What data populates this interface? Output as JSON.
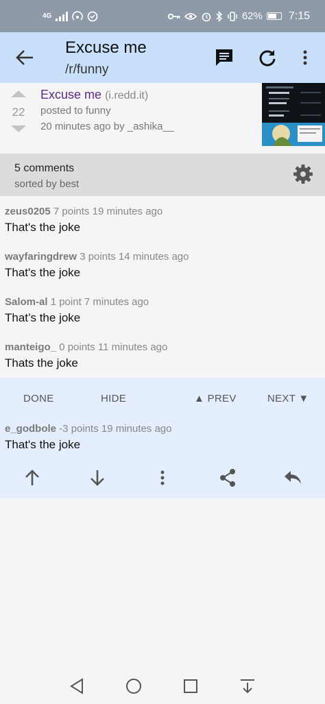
{
  "status_bar": {
    "network": "4G",
    "battery": "62%",
    "time": "7:15"
  },
  "app_bar": {
    "title": "Excuse me",
    "subtitle": "/r/funny"
  },
  "post": {
    "score": "22",
    "title": "Excuse me",
    "domain": "(i.redd.it)",
    "posted_to": "posted to funny",
    "time_by": "20 minutes ago by _ashika__"
  },
  "comments_header": {
    "count": "5 comments",
    "sort": "sorted by best"
  },
  "comments": [
    {
      "author": "zeus0205",
      "points": "7 points",
      "time": "19 minutes ago",
      "body": "That's the joke"
    },
    {
      "author": "wayfaringdrew",
      "points": "3 points",
      "time": "14 minutes ago",
      "body": "That's the joke"
    },
    {
      "author": "Salom-al",
      "points": "1 point",
      "time": "7 minutes ago",
      "body": "That’s the joke"
    },
    {
      "author": "manteigo_",
      "points": "0 points",
      "time": "11 minutes ago",
      "body": "Thats the joke"
    }
  ],
  "selected": {
    "done": "DONE",
    "hide": "HIDE",
    "prev": "▲ PREV",
    "next": "NEXT ▼",
    "comment": {
      "author": "e_godbole",
      "points": "-3 points",
      "time": "19 minutes ago",
      "body": "That's the joke"
    }
  },
  "icons": {
    "back": "arrow-left-icon",
    "comments": "comment-icon",
    "refresh": "refresh-icon",
    "overflow": "more-vert-icon",
    "settings": "gear-icon",
    "upvote": "arrow-up-icon",
    "downvote": "arrow-down-icon",
    "share": "share-icon",
    "reply": "reply-icon"
  },
  "colors": {
    "app_bar": "#c9e0fa",
    "status_bar": "#8e9aa8",
    "selected_panel": "#e4eefc",
    "post_title": "#5b2a86"
  }
}
